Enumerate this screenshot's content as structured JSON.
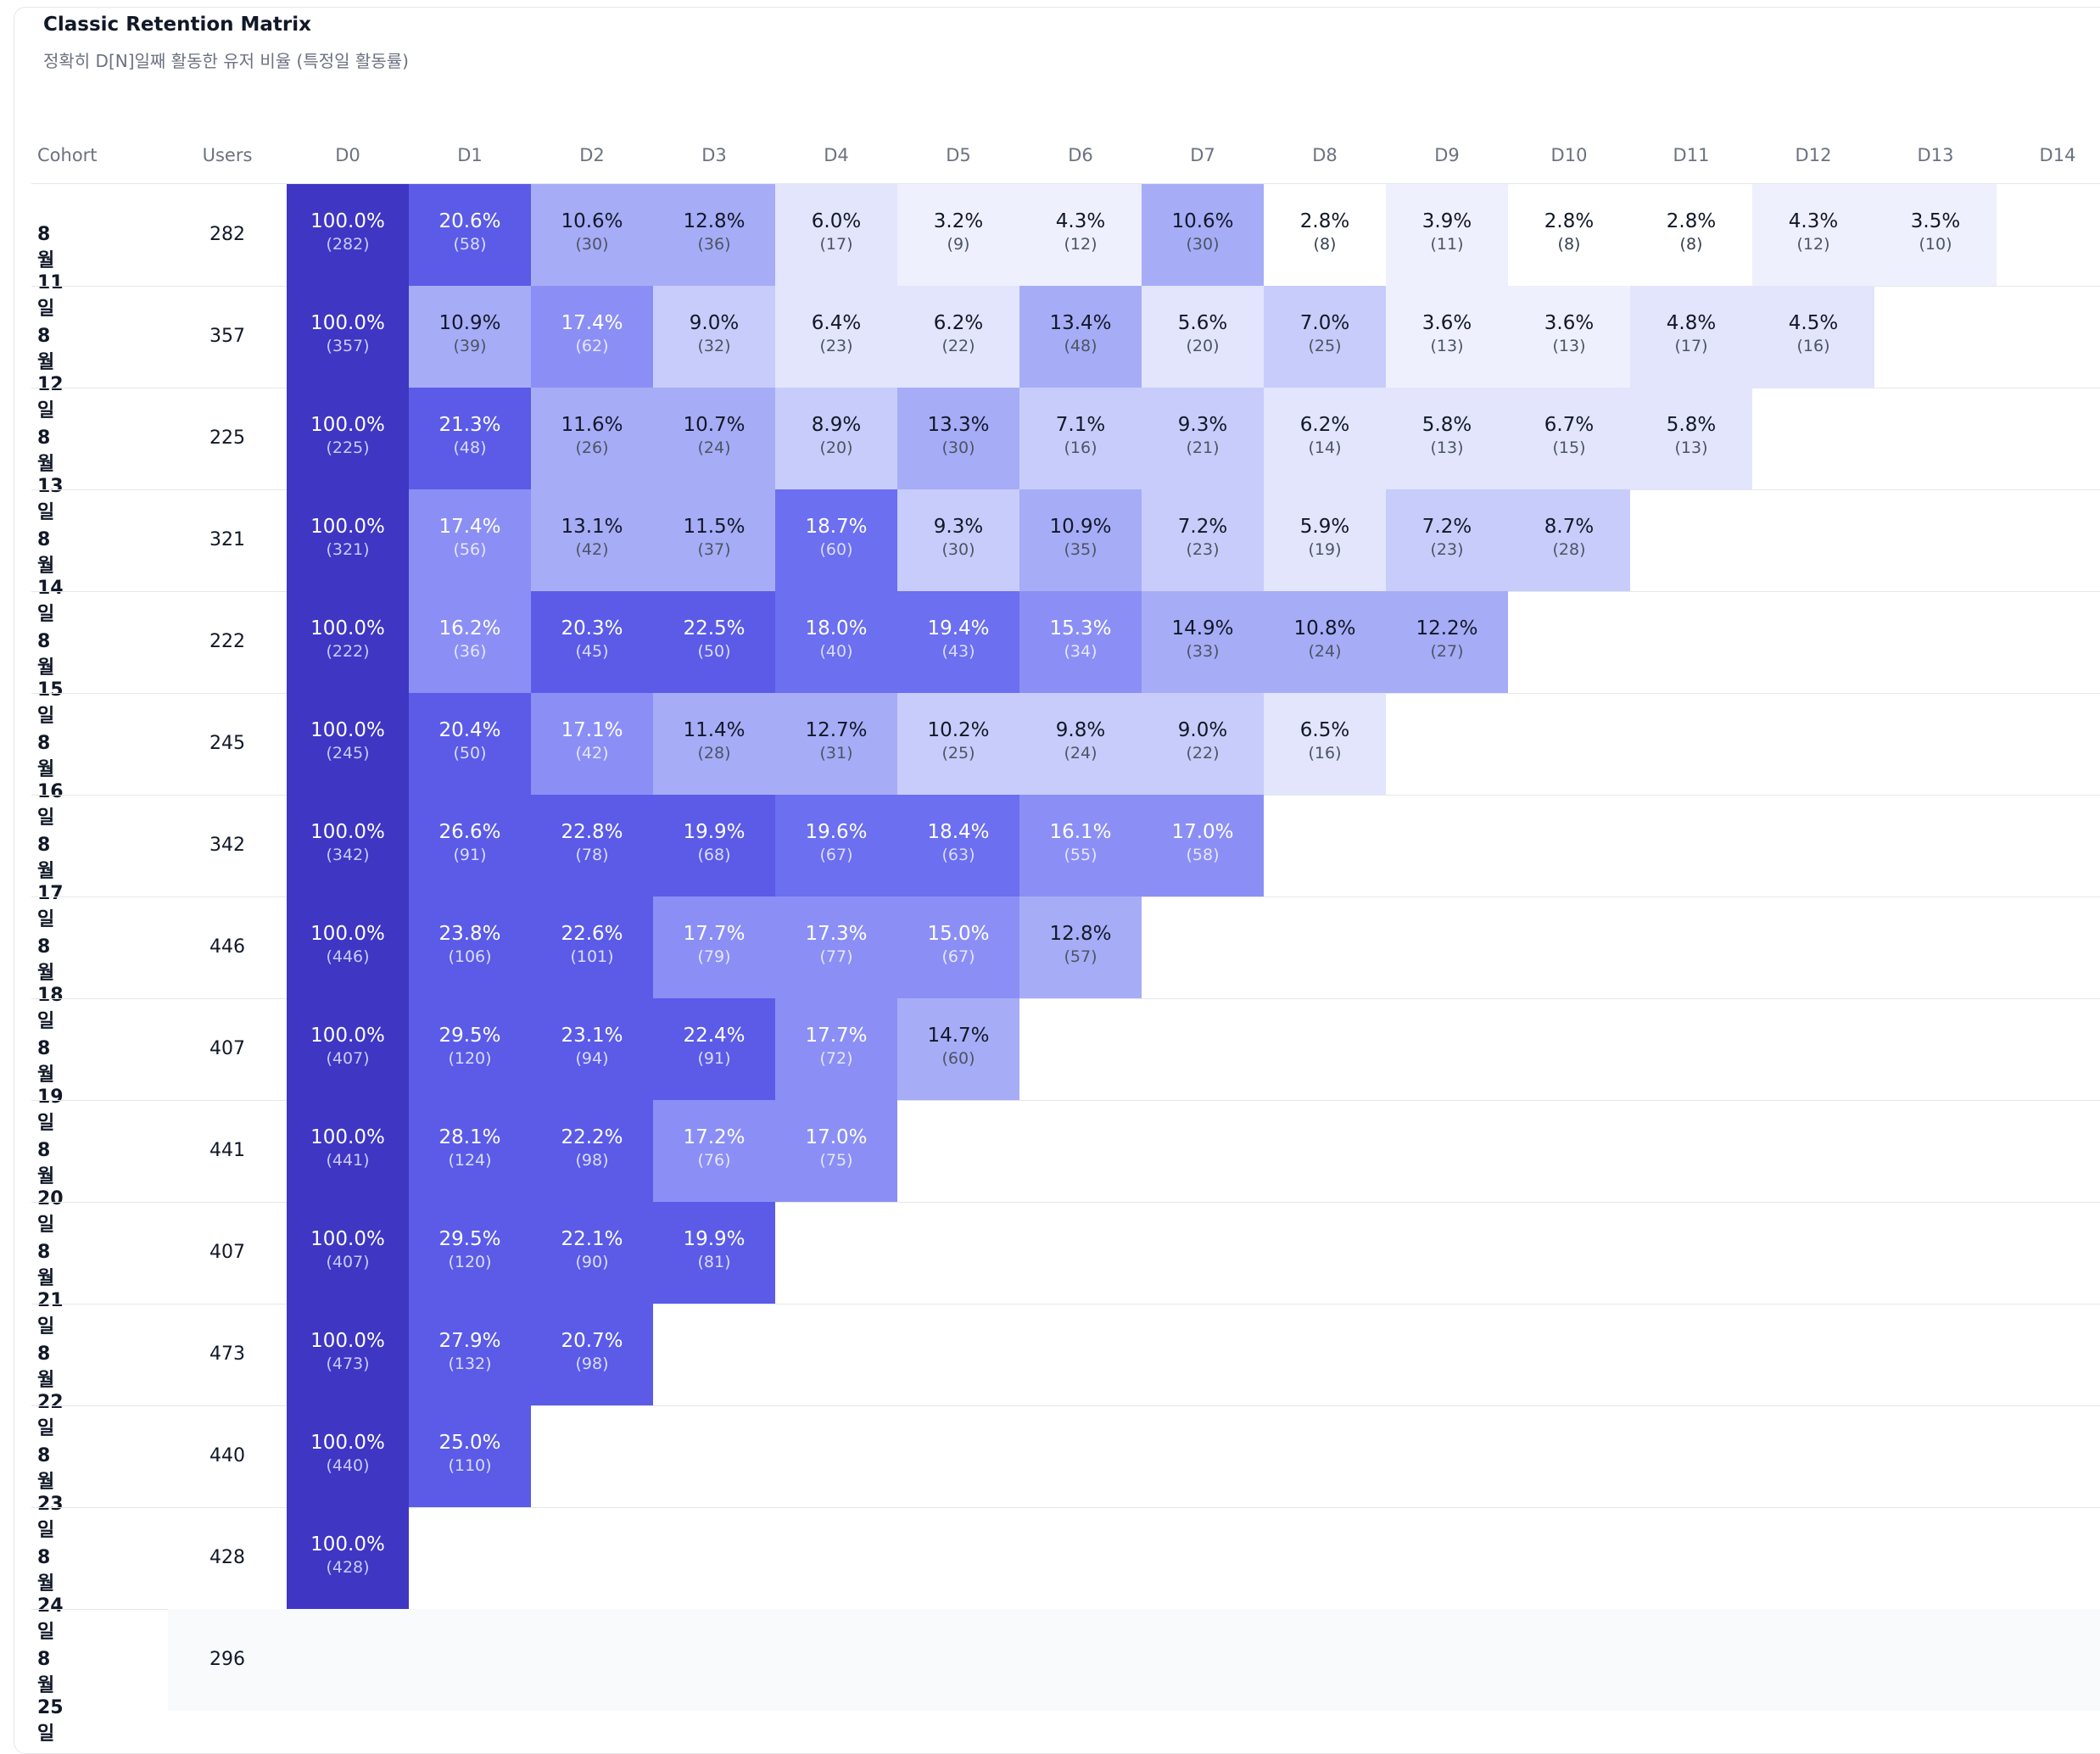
{
  "title": "Classic Retention Matrix",
  "subtitle": "정확히 D[N]일째 활동한 유저 비율 (특정일 활동률)",
  "columns": {
    "cohort": "Cohort",
    "users": "Users",
    "days": [
      "D0",
      "D1",
      "D2",
      "D3",
      "D4",
      "D5",
      "D6",
      "D7",
      "D8",
      "D9",
      "D10",
      "D11",
      "D12",
      "D13",
      "D14"
    ]
  },
  "chart_data": {
    "type": "heatmap",
    "title": "Classic Retention Matrix",
    "subtitle": "정확히 D[N]일째 활동한 유저 비율 (특정일 활동률)",
    "x_categories": [
      "D0",
      "D1",
      "D2",
      "D3",
      "D4",
      "D5",
      "D6",
      "D7",
      "D8",
      "D9",
      "D10",
      "D11",
      "D12",
      "D13",
      "D14"
    ],
    "rows": [
      {
        "cohort": "8월 11일",
        "users": "282",
        "pct": [
          "100.0%",
          "20.6%",
          "10.6%",
          "12.8%",
          "6.0%",
          "3.2%",
          "4.3%",
          "10.6%",
          "2.8%",
          "3.9%",
          "2.8%",
          "2.8%",
          "4.3%",
          "3.5%"
        ],
        "count": [
          "(282)",
          "(58)",
          "(30)",
          "(36)",
          "(17)",
          "(9)",
          "(12)",
          "(30)",
          "(8)",
          "(11)",
          "(8)",
          "(8)",
          "(12)",
          "(10)"
        ]
      },
      {
        "cohort": "8월 12일",
        "users": "357",
        "pct": [
          "100.0%",
          "10.9%",
          "17.4%",
          "9.0%",
          "6.4%",
          "6.2%",
          "13.4%",
          "5.6%",
          "7.0%",
          "3.6%",
          "3.6%",
          "4.8%",
          "4.5%"
        ],
        "count": [
          "(357)",
          "(39)",
          "(62)",
          "(32)",
          "(23)",
          "(22)",
          "(48)",
          "(20)",
          "(25)",
          "(13)",
          "(13)",
          "(17)",
          "(16)"
        ]
      },
      {
        "cohort": "8월 13일",
        "users": "225",
        "pct": [
          "100.0%",
          "21.3%",
          "11.6%",
          "10.7%",
          "8.9%",
          "13.3%",
          "7.1%",
          "9.3%",
          "6.2%",
          "5.8%",
          "6.7%",
          "5.8%"
        ],
        "count": [
          "(225)",
          "(48)",
          "(26)",
          "(24)",
          "(20)",
          "(30)",
          "(16)",
          "(21)",
          "(14)",
          "(13)",
          "(15)",
          "(13)"
        ]
      },
      {
        "cohort": "8월 14일",
        "users": "321",
        "pct": [
          "100.0%",
          "17.4%",
          "13.1%",
          "11.5%",
          "18.7%",
          "9.3%",
          "10.9%",
          "7.2%",
          "5.9%",
          "7.2%",
          "8.7%"
        ],
        "count": [
          "(321)",
          "(56)",
          "(42)",
          "(37)",
          "(60)",
          "(30)",
          "(35)",
          "(23)",
          "(19)",
          "(23)",
          "(28)"
        ]
      },
      {
        "cohort": "8월 15일",
        "users": "222",
        "pct": [
          "100.0%",
          "16.2%",
          "20.3%",
          "22.5%",
          "18.0%",
          "19.4%",
          "15.3%",
          "14.9%",
          "10.8%",
          "12.2%"
        ],
        "count": [
          "(222)",
          "(36)",
          "(45)",
          "(50)",
          "(40)",
          "(43)",
          "(34)",
          "(33)",
          "(24)",
          "(27)"
        ]
      },
      {
        "cohort": "8월 16일",
        "users": "245",
        "pct": [
          "100.0%",
          "20.4%",
          "17.1%",
          "11.4%",
          "12.7%",
          "10.2%",
          "9.8%",
          "9.0%",
          "6.5%"
        ],
        "count": [
          "(245)",
          "(50)",
          "(42)",
          "(28)",
          "(31)",
          "(25)",
          "(24)",
          "(22)",
          "(16)"
        ]
      },
      {
        "cohort": "8월 17일",
        "users": "342",
        "pct": [
          "100.0%",
          "26.6%",
          "22.8%",
          "19.9%",
          "19.6%",
          "18.4%",
          "16.1%",
          "17.0%"
        ],
        "count": [
          "(342)",
          "(91)",
          "(78)",
          "(68)",
          "(67)",
          "(63)",
          "(55)",
          "(58)"
        ]
      },
      {
        "cohort": "8월 18일",
        "users": "446",
        "pct": [
          "100.0%",
          "23.8%",
          "22.6%",
          "17.7%",
          "17.3%",
          "15.0%",
          "12.8%"
        ],
        "count": [
          "(446)",
          "(106)",
          "(101)",
          "(79)",
          "(77)",
          "(67)",
          "(57)"
        ]
      },
      {
        "cohort": "8월 19일",
        "users": "407",
        "pct": [
          "100.0%",
          "29.5%",
          "23.1%",
          "22.4%",
          "17.7%",
          "14.7%"
        ],
        "count": [
          "(407)",
          "(120)",
          "(94)",
          "(91)",
          "(72)",
          "(60)"
        ]
      },
      {
        "cohort": "8월 20일",
        "users": "441",
        "pct": [
          "100.0%",
          "28.1%",
          "22.2%",
          "17.2%",
          "17.0%"
        ],
        "count": [
          "(441)",
          "(124)",
          "(98)",
          "(76)",
          "(75)"
        ]
      },
      {
        "cohort": "8월 21일",
        "users": "407",
        "pct": [
          "100.0%",
          "29.5%",
          "22.1%",
          "19.9%"
        ],
        "count": [
          "(407)",
          "(120)",
          "(90)",
          "(81)"
        ]
      },
      {
        "cohort": "8월 22일",
        "users": "473",
        "pct": [
          "100.0%",
          "27.9%",
          "20.7%"
        ],
        "count": [
          "(473)",
          "(132)",
          "(98)"
        ]
      },
      {
        "cohort": "8월 23일",
        "users": "440",
        "pct": [
          "100.0%",
          "25.0%"
        ],
        "count": [
          "(440)",
          "(110)"
        ]
      },
      {
        "cohort": "8월 24일",
        "users": "428",
        "pct": [
          "100.0%"
        ],
        "count": [
          "(428)"
        ]
      },
      {
        "cohort": "8월 25일",
        "users": "296",
        "pct": [],
        "count": []
      }
    ],
    "color_scale": {
      "d0": "#3f36c4",
      "very_high": "#5b5be8",
      "high": "#6b6ff0",
      "mid_high": "#8b8ff5",
      "mid": "#a7acf7",
      "low": "#c8ccfa",
      "very_low": "#e2e5fc",
      "minimal": "#eef0fd",
      "none": "#ffffff"
    }
  }
}
